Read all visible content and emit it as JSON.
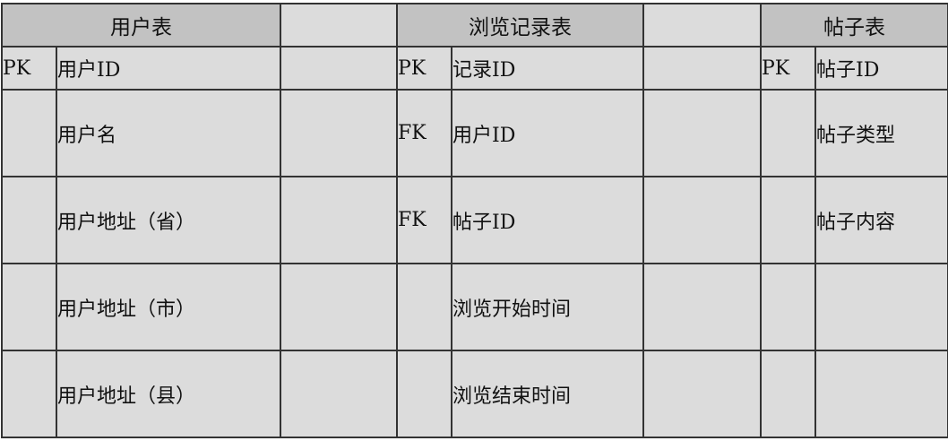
{
  "tables": [
    {
      "title": "用户表"
    },
    {
      "title": "浏览记录表"
    },
    {
      "title": "帖子表"
    }
  ],
  "rows": [
    [
      "PK",
      "用户ID",
      "",
      "PK",
      "记录ID",
      "",
      "PK",
      "帖子ID"
    ],
    [
      "",
      "用户名",
      "",
      "FK",
      "用户ID",
      "",
      "",
      "帖子类型"
    ],
    [
      "",
      "用户地址（省）",
      "",
      "FK",
      "帖子ID",
      "",
      "",
      "帖子内容"
    ],
    [
      "",
      "用户地址（市）",
      "",
      "",
      "浏览开始时间",
      "",
      "",
      ""
    ],
    [
      "",
      "用户地址（县）",
      "",
      "",
      "浏览结束时间",
      "",
      "",
      ""
    ]
  ]
}
